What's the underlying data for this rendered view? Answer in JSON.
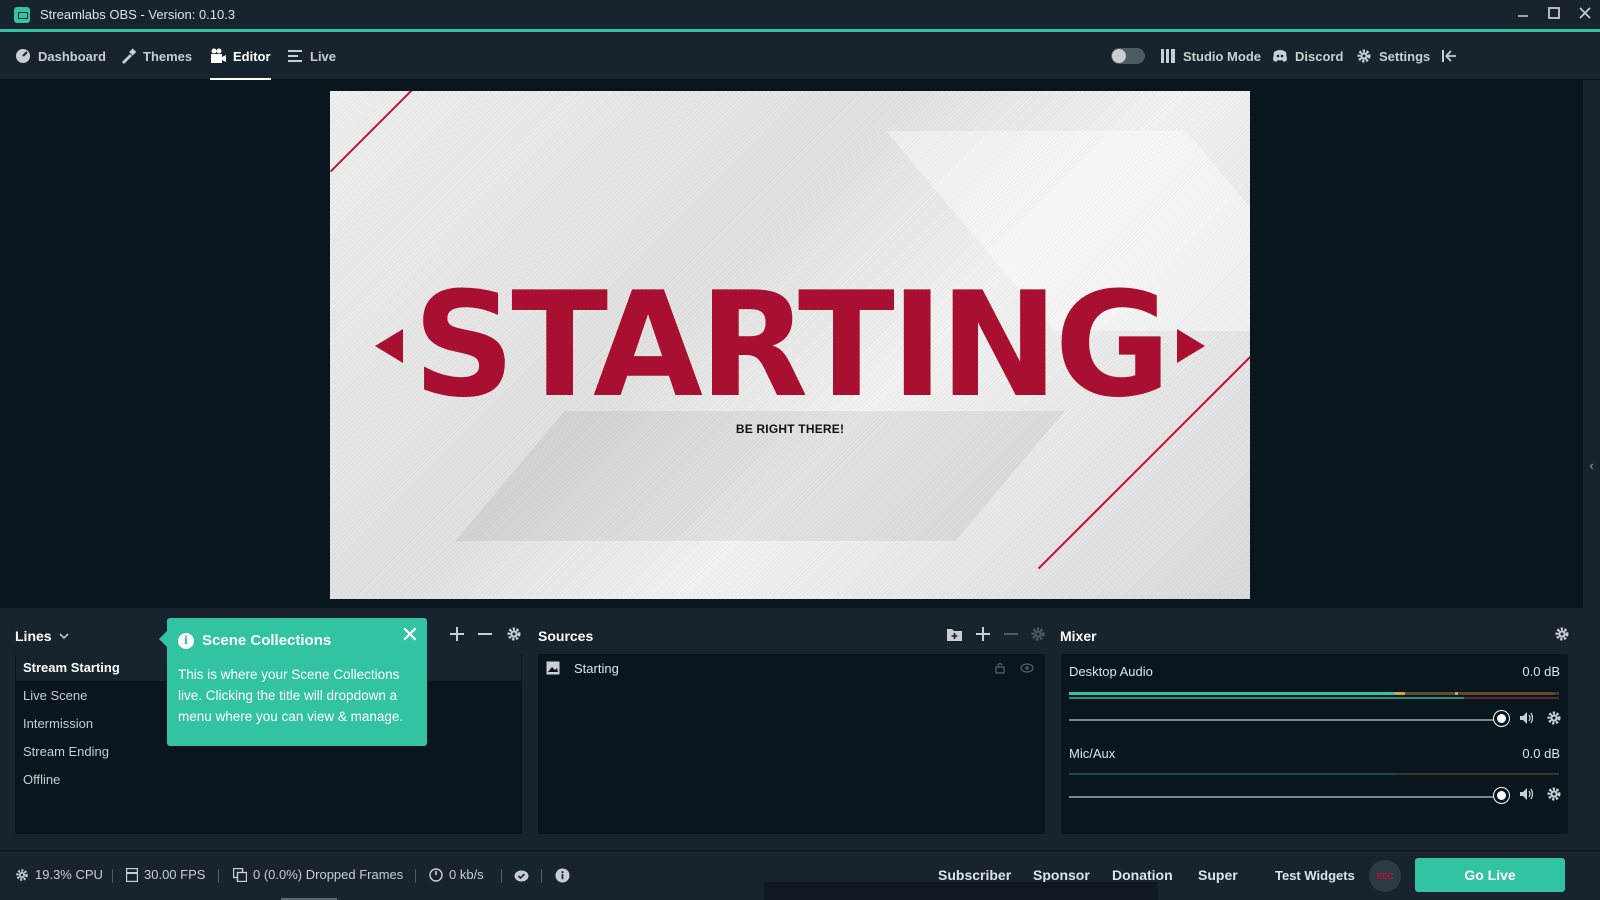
{
  "window": {
    "title": "Streamlabs OBS - Version: 0.10.3"
  },
  "nav": {
    "dashboard": "Dashboard",
    "themes": "Themes",
    "editor": "Editor",
    "live": "Live",
    "studio_mode": "Studio Mode",
    "discord": "Discord",
    "settings": "Settings"
  },
  "preview": {
    "headline": "STARTING",
    "subline": "BE RIGHT THERE!"
  },
  "scenes": {
    "collection_title": "Lines",
    "items": [
      {
        "label": "Stream Starting",
        "selected": true
      },
      {
        "label": "Live Scene",
        "selected": false
      },
      {
        "label": "Intermission",
        "selected": false
      },
      {
        "label": "Stream Ending",
        "selected": false
      },
      {
        "label": "Offline",
        "selected": false
      }
    ]
  },
  "tooltip": {
    "title": "Scene Collections",
    "body": "This is where your Scene Collections live. Clicking the title will dropdown a menu where you can view & manage.",
    "close": "✕"
  },
  "sources": {
    "title": "Sources",
    "items": [
      {
        "label": "Starting"
      }
    ]
  },
  "mixer": {
    "title": "Mixer",
    "channels": [
      {
        "name": "Desktop Audio",
        "db": "0.0 dB",
        "volume": 1.0
      },
      {
        "name": "Mic/Aux",
        "db": "0.0 dB",
        "volume": 1.0
      }
    ]
  },
  "footer": {
    "cpu": "19.3% CPU",
    "fps": "30.00 FPS",
    "dropped": "0 (0.0%) Dropped Frames",
    "bitrate": "0 kb/s",
    "widgets": [
      "Subscriber",
      "Sponsor",
      "Donation",
      "Super"
    ],
    "test_widgets": "Test Widgets",
    "rec": "REC",
    "go_live": "Go Live"
  },
  "colors": {
    "accent": "#31c3a2",
    "brand_red": "#a80f30",
    "panel_bg": "#17242d",
    "page_bg": "#09161d"
  }
}
